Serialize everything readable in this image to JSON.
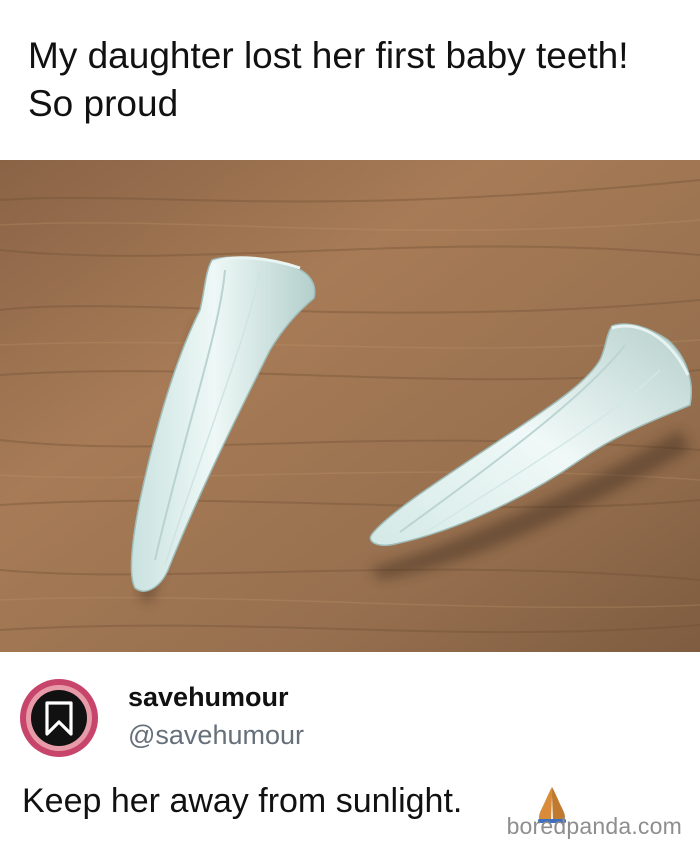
{
  "post": {
    "title": "My daughter lost her first baby teeth! So proud"
  },
  "photo": {
    "subject": "two white tapered tooth-like objects on a wooden surface"
  },
  "tweet": {
    "display_name": "savehumour",
    "handle": "@savehumour",
    "text": "Keep her away from sunlight.",
    "emoji_icon": "folded-hands-icon",
    "avatar_icon": "bookmark-icon"
  },
  "watermark": {
    "text": "boredpanda.com"
  },
  "colors": {
    "wood": "#9a6f4c",
    "avatar_ring": "#c7456a",
    "handle": "#66707a"
  }
}
